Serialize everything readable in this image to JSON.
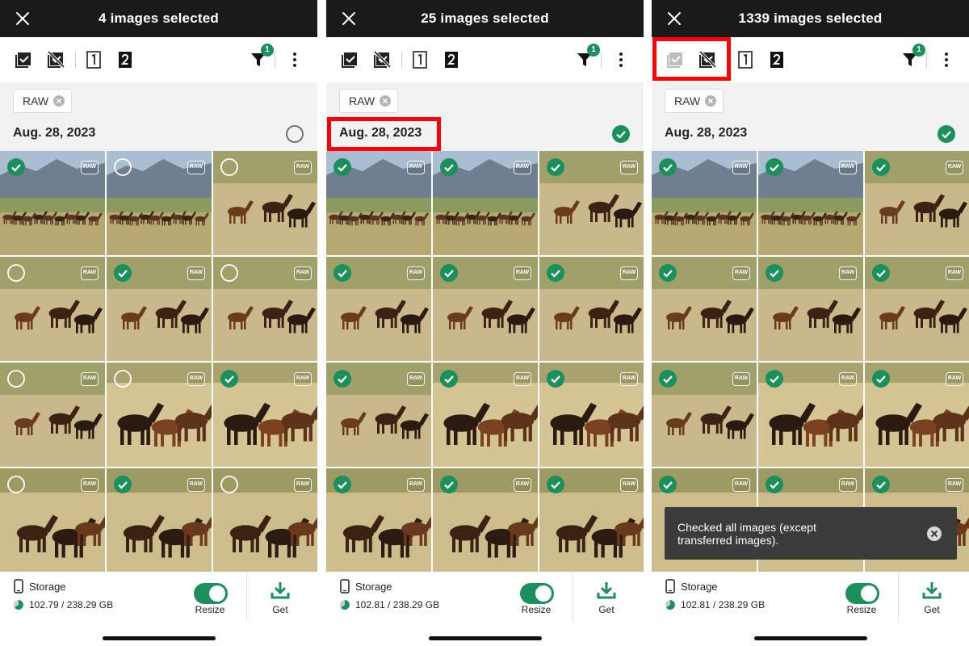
{
  "panels": [
    {
      "title": "4 images selected",
      "filter_badge": "1",
      "chip_label": "RAW",
      "date": "Aug. 28, 2023",
      "date_checked": false,
      "checks": [
        true,
        false,
        false,
        false,
        true,
        false,
        false,
        false,
        true,
        false,
        true,
        false
      ],
      "storage_label": "Storage",
      "storage_value": "102.79 / 238.29 GB",
      "resize_label": "Resize",
      "get_label": "Get"
    },
    {
      "title": "25 images selected",
      "filter_badge": "1",
      "chip_label": "RAW",
      "date": "Aug. 28, 2023",
      "date_checked": true,
      "checks": [
        true,
        true,
        true,
        true,
        true,
        true,
        true,
        true,
        true,
        true,
        true,
        true
      ],
      "storage_label": "Storage",
      "storage_value": "102.81 / 238.29 GB",
      "resize_label": "Resize",
      "get_label": "Get"
    },
    {
      "title": "1339 images selected",
      "filter_badge": "1",
      "chip_label": "RAW",
      "date": "Aug. 28, 2023",
      "date_checked": true,
      "checks": [
        true,
        true,
        true,
        true,
        true,
        true,
        true,
        true,
        true,
        true,
        true,
        true
      ],
      "storage_label": "Storage",
      "storage_value": "102.81 / 238.29 GB",
      "resize_label": "Resize",
      "get_label": "Get"
    }
  ],
  "raw_badge": "RAW",
  "toast": {
    "line1": "Checked all images (except",
    "line2": "transferred images)."
  },
  "colors": {
    "accent": "#1b8f5c",
    "highlight": "#ff0000",
    "topbar": "#1a1a1a",
    "toast": "#3b3b3b"
  },
  "icons": [
    "close-icon",
    "check-all-icon",
    "uncheck-all-icon",
    "slot-1-icon",
    "slot-2-icon",
    "filter-icon",
    "more-vert-icon",
    "chip-remove-icon",
    "phone-icon",
    "storage-pie-icon",
    "download-icon"
  ]
}
